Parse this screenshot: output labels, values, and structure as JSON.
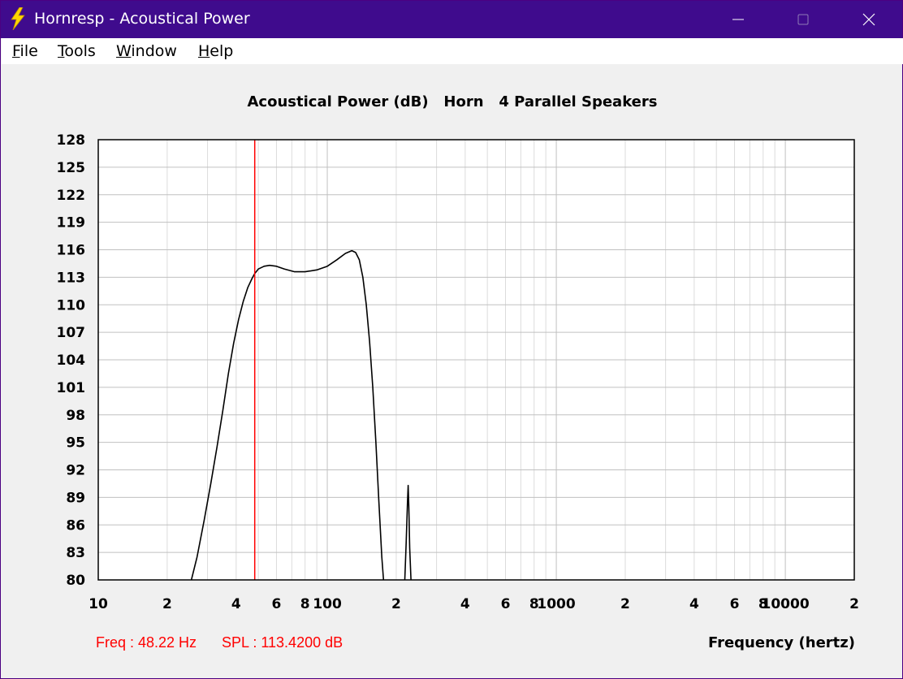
{
  "window": {
    "title": "Hornresp - Acoustical Power",
    "minimize_label": "Minimize",
    "maximize_label": "Maximize",
    "close_label": "Close",
    "titlebar_color": "#3f0b8d"
  },
  "menu": {
    "items": [
      {
        "label": "File",
        "accel": "F"
      },
      {
        "label": "Tools",
        "accel": "T"
      },
      {
        "label": "Window",
        "accel": "W"
      },
      {
        "label": "Help",
        "accel": "H"
      }
    ]
  },
  "readout": {
    "freq": "Freq : 48.22 Hz",
    "spl": "SPL : 113.4200 dB",
    "color": "#ff0000"
  },
  "chart_data": {
    "type": "line",
    "title": "Acoustical Power (dB)   Horn   4 Parallel Speakers",
    "xlabel": "Frequency (hertz)",
    "ylabel": "",
    "xscale": "log",
    "xlim": [
      10,
      20000
    ],
    "ylim": [
      80,
      128
    ],
    "grid": true,
    "y_ticks": [
      128,
      125,
      122,
      119,
      116,
      113,
      110,
      107,
      104,
      101,
      98,
      95,
      92,
      89,
      86,
      83,
      80
    ],
    "x_tick_labels": [
      {
        "x": 10,
        "label": "10"
      },
      {
        "x": 20,
        "label": "2"
      },
      {
        "x": 40,
        "label": "4"
      },
      {
        "x": 60,
        "label": "6"
      },
      {
        "x": 80,
        "label": "8"
      },
      {
        "x": 100,
        "label": "100"
      },
      {
        "x": 200,
        "label": "2"
      },
      {
        "x": 400,
        "label": "4"
      },
      {
        "x": 600,
        "label": "6"
      },
      {
        "x": 800,
        "label": "8"
      },
      {
        "x": 1000,
        "label": "1000"
      },
      {
        "x": 2000,
        "label": "2"
      },
      {
        "x": 4000,
        "label": "4"
      },
      {
        "x": 6000,
        "label": "6"
      },
      {
        "x": 8000,
        "label": "8"
      },
      {
        "x": 10000,
        "label": "10000"
      },
      {
        "x": 20000,
        "label": "2"
      }
    ],
    "cursor": {
      "x": 48.22,
      "color": "#ff0000"
    },
    "series": [
      {
        "color": "#000000",
        "segments": [
          [
            [
              25.5,
              80
            ],
            [
              27,
              82.5
            ],
            [
              29,
              86.5
            ],
            [
              31,
              90.5
            ],
            [
              33,
              94.5
            ],
            [
              35,
              98.5
            ],
            [
              37,
              102.5
            ],
            [
              39,
              105.8
            ],
            [
              41,
              108.4
            ],
            [
              43,
              110.4
            ],
            [
              45,
              111.9
            ],
            [
              47,
              112.9
            ],
            [
              48.2,
              113.4
            ],
            [
              50,
              113.9
            ],
            [
              53,
              114.2
            ],
            [
              56,
              114.3
            ],
            [
              60,
              114.2
            ],
            [
              65,
              113.9
            ],
            [
              72,
              113.6
            ],
            [
              80,
              113.6
            ],
            [
              90,
              113.8
            ],
            [
              100,
              114.2
            ],
            [
              110,
              114.9
            ],
            [
              120,
              115.6
            ],
            [
              128,
              115.9
            ],
            [
              133,
              115.7
            ],
            [
              138,
              114.9
            ],
            [
              143,
              113.0
            ],
            [
              148,
              110.0
            ],
            [
              153,
              106.0
            ],
            [
              158,
              101.0
            ],
            [
              163,
              95.0
            ],
            [
              168,
              88.5
            ],
            [
              173,
              82.5
            ],
            [
              176,
              80
            ]
          ],
          [
            [
              218,
              80
            ],
            [
              221,
              84
            ],
            [
              224,
              88.5
            ],
            [
              225.5,
              90.3
            ],
            [
              227,
              88
            ],
            [
              229,
              83.5
            ],
            [
              232,
              80
            ]
          ]
        ]
      }
    ]
  }
}
